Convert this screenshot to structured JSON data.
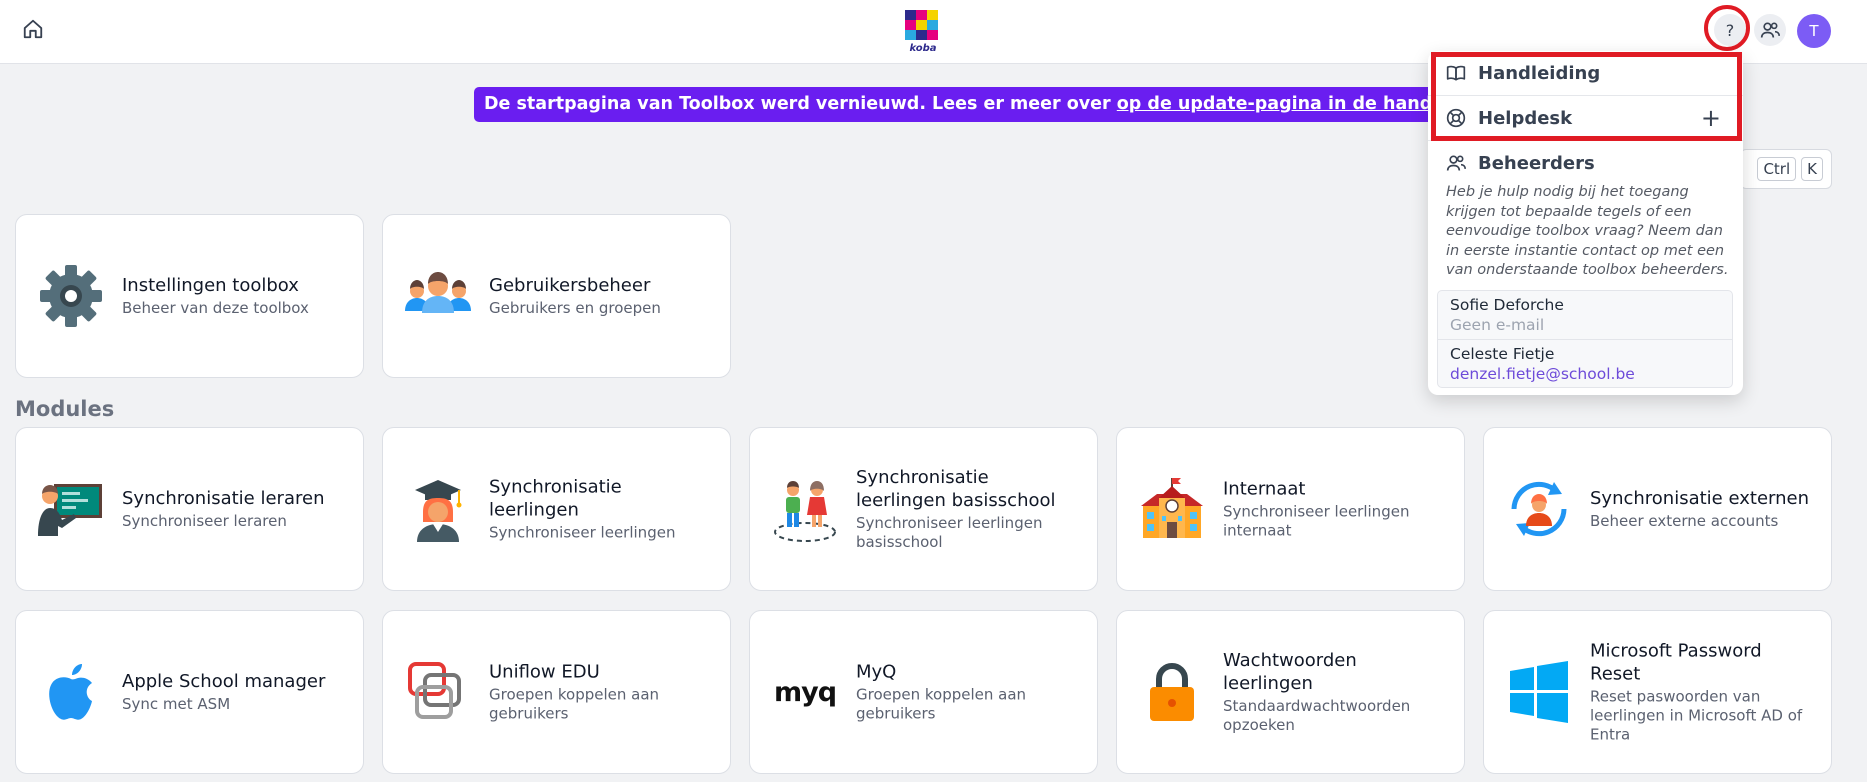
{
  "colors": {
    "accent": "#6a1ef0",
    "avatar": "#7c5cf5",
    "highlight": "#e01b24",
    "link": "#6d4bd9"
  },
  "header": {
    "logo_text": "koba",
    "help_label": "?",
    "avatar_initial": "T"
  },
  "banner": {
    "text": "De startpagina van Toolbox werd vernieuwd. Lees er meer over ",
    "link": "op de update-pagina in de handleiding",
    "suffix": "."
  },
  "search_shortcut": {
    "key1": "Ctrl",
    "key2": "K"
  },
  "admin_tiles": [
    {
      "title": "Instellingen toolbox",
      "subtitle": "Beheer van deze toolbox",
      "icon": "gear-icon"
    },
    {
      "title": "Gebruikersbeheer",
      "subtitle": "Gebruikers en groepen",
      "icon": "users-icon"
    }
  ],
  "modules_title": "Modules",
  "modules": [
    {
      "title": "Synchronisatie leraren",
      "subtitle": "Synchroniseer leraren",
      "icon": "teacher-icon"
    },
    {
      "title": "Synchronisatie leerlingen",
      "subtitle": "Synchroniseer leerlingen",
      "icon": "graduate-icon"
    },
    {
      "title": "Synchronisatie leerlingen basisschool",
      "subtitle": "Synchroniseer leerlingen basisschool",
      "icon": "kids-icon"
    },
    {
      "title": "Internaat",
      "subtitle": "Synchroniseer leerlingen internaat",
      "icon": "school-building-icon"
    },
    {
      "title": "Synchronisatie externen",
      "subtitle": "Beheer externe accounts",
      "icon": "sync-person-icon"
    },
    {
      "title": "Apple School manager",
      "subtitle": "Sync met ASM",
      "icon": "apple-icon"
    },
    {
      "title": "Uniflow EDU",
      "subtitle": "Groepen koppelen aan gebruikers",
      "icon": "uniflow-icon"
    },
    {
      "title": "MyQ",
      "subtitle": "Groepen koppelen aan gebruikers",
      "icon": "myq-logo",
      "logo_text": "myq"
    },
    {
      "title": "Wachtwoorden leerlingen",
      "subtitle": "Standaardwachtwoorden opzoeken",
      "icon": "padlock-icon"
    },
    {
      "title": "Microsoft Password Reset",
      "subtitle": "Reset paswoorden van leerlingen in Microsoft AD of Entra",
      "icon": "windows-icon"
    }
  ],
  "help_menu": {
    "items": [
      {
        "label": "Handleiding",
        "icon": "book-icon"
      },
      {
        "label": "Helpdesk",
        "icon": "lifebuoy-icon",
        "action": "+"
      },
      {
        "label": "Beheerders",
        "icon": "users-icon"
      }
    ],
    "note": "Heb je hulp nodig bij het toegang krijgen tot bepaalde tegels of een eenvoudige toolbox vraag? Neem dan in eerste instantie contact op met een van onderstaande toolbox beheerders.",
    "admins": [
      {
        "name": "Sofie Deforche",
        "email": "Geen e-mail"
      },
      {
        "name": "Celeste Fietje",
        "email": "denzel.fietje@school.be"
      }
    ]
  }
}
